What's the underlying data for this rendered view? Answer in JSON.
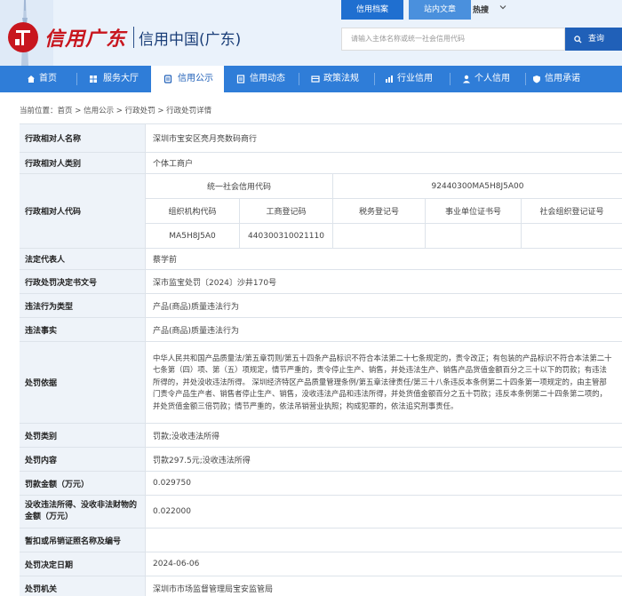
{
  "header": {
    "brand_logo_text": "信用广东",
    "brand_site_title": "信用中国(广东)",
    "top_tabs": [
      "信用档案",
      "站内文章"
    ],
    "hot_label": "热搜",
    "search_placeholder": "请输入主体名称或统一社会信用代码",
    "search_button": "查询"
  },
  "nav": {
    "items": [
      {
        "label": "首页",
        "icon": "home-icon"
      },
      {
        "label": "服务大厅",
        "icon": "grid-icon"
      },
      {
        "label": "信用公示",
        "icon": "announce-icon",
        "active": true
      },
      {
        "label": "信用动态",
        "icon": "document-icon"
      },
      {
        "label": "政策法规",
        "icon": "policy-icon"
      },
      {
        "label": "行业信用",
        "icon": "industry-icon"
      },
      {
        "label": "个人信用",
        "icon": "person-icon"
      },
      {
        "label": "信用承诺",
        "icon": "shield-icon"
      }
    ]
  },
  "breadcrumb": {
    "prefix": "当前位置：",
    "items": [
      "首页",
      "信用公示",
      "行政处罚",
      "行政处罚详情"
    ],
    "separator": " > "
  },
  "detail": {
    "rows": [
      {
        "label": "行政相对人名称",
        "value": "深圳市宝安区亮月亮数码商行"
      },
      {
        "label": "行政相对人类别",
        "value": "个体工商户"
      },
      {
        "label": "行政相对人代码"
      },
      {
        "label": "法定代表人",
        "value": "蔡学前"
      },
      {
        "label": "行政处罚决定书文号",
        "value": "深市监宝处罚〔2024〕沙井170号"
      },
      {
        "label": "违法行为类型",
        "value": "产品(商品)质量违法行为"
      },
      {
        "label": "违法事实",
        "value": "产品(商品)质量违法行为"
      },
      {
        "label": "处罚依据",
        "value": "中华人民共和国产品质量法/第五章罚则/第五十四条产品标识不符合本法第二十七条规定的，责令改正；有包装的产品标识不符合本法第二十七条第（四）项、第（五）项规定，情节严重的，责令停止生产、销售，并处违法生产、销售产品货值金额百分之三十以下的罚款；有违法所得的，并处没收违法所得。 深圳经济特区产品质量管理条例/第五章法律责任/第三十八条违反本条例第二十四条第一项规定的，由主管部门责令产品生产者、销售者停止生产、销售，没收违法产品和违法所得，并处货值金额百分之五十罚款；违反本条例第二十四条第二项的，并处货值金额三倍罚款；情节严重的，依法吊销营业执照；构成犯罪的，依法追究刑事责任。"
      },
      {
        "label": "处罚类别",
        "value": "罚款;没收违法所得"
      },
      {
        "label": "处罚内容",
        "value": "罚款297.5元;没收违法所得"
      },
      {
        "label": "罚款金额（万元）",
        "value": "0.029750"
      },
      {
        "label": "没收违法所得、没收非法财物的金额（万元）",
        "value": "0.022000"
      },
      {
        "label": "暂扣或吊销证照名称及编号",
        "value": ""
      },
      {
        "label": "处罚决定日期",
        "value": "2024-06-06"
      },
      {
        "label": "处罚机关",
        "value": "深圳市市场监督管理局宝安监管局"
      }
    ],
    "codes": {
      "uscc_label": "统一社会信用代码",
      "uscc_value": "92440300MA5H8J5A00",
      "headers": [
        "组织机构代码",
        "工商登记码",
        "税务登记号",
        "事业单位证书号",
        "社会组织登记证号"
      ],
      "values": [
        "MA5H8J5A0",
        "440300310021110",
        "",
        "",
        ""
      ]
    }
  },
  "colors": {
    "nav_bg": "#2f7dd8",
    "label_bg": "#eef3f9",
    "brand_red": "#c8161e",
    "search_btn": "#2060b8"
  }
}
